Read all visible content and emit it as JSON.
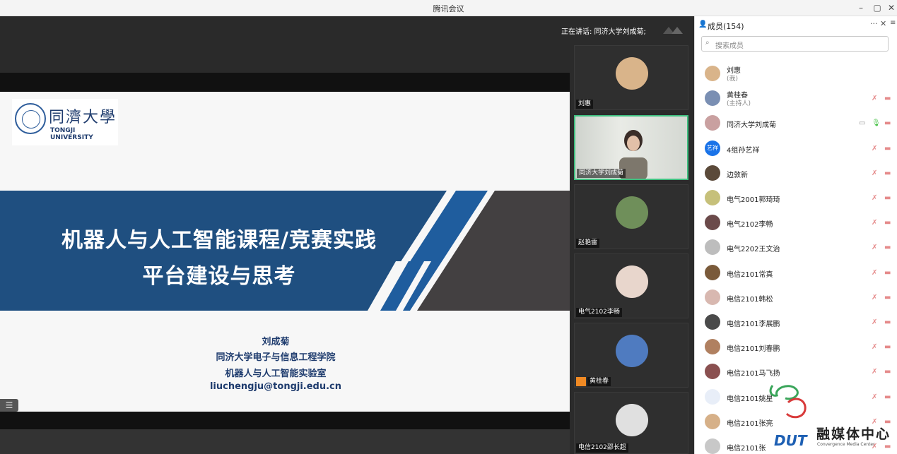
{
  "window": {
    "title": "腾讯会议"
  },
  "speaking": {
    "text": "正在讲话: 同济大学刘成菊;"
  },
  "slide": {
    "logo_cn": "同濟大學",
    "logo_en": "TONGJI UNIVERSITY",
    "title_line1": "机器人与人工智能课程/竞赛实践",
    "title_line2": "平台建设与思考",
    "author": "刘成菊",
    "affiliation1": "同济大学电子与信息工程学院",
    "affiliation2": "机器人与人工智能实验室",
    "email": "liuchengju@tongji.edu.cn"
  },
  "thumbnails": [
    {
      "name": "刘惠"
    },
    {
      "name": "同济大学刘成菊"
    },
    {
      "name": "赵艳雷"
    },
    {
      "name": "电气2102李畅"
    },
    {
      "name": "黄桂春"
    },
    {
      "name": "电信2102邵长超"
    }
  ],
  "panel": {
    "title": "成员(154)",
    "search_placeholder": "搜索成员",
    "members": [
      {
        "name": "刘惠",
        "sub": "(我)"
      },
      {
        "name": "黄桂春",
        "sub": "(主持人)"
      },
      {
        "name": "同济大学刘成菊",
        "sub": ""
      },
      {
        "name": "4组孙艺祥",
        "sub": "",
        "avatar_text": "艺祥"
      },
      {
        "name": "边敦新",
        "sub": ""
      },
      {
        "name": "电气2001郭琦琦",
        "sub": ""
      },
      {
        "name": "电气2102李畅",
        "sub": ""
      },
      {
        "name": "电气2202王文治",
        "sub": ""
      },
      {
        "name": "电信2101常真",
        "sub": ""
      },
      {
        "name": "电信2101韩松",
        "sub": ""
      },
      {
        "name": "电信2101李展鹏",
        "sub": ""
      },
      {
        "name": "电信2101刘春鹏",
        "sub": ""
      },
      {
        "name": "电信2101马飞扬",
        "sub": ""
      },
      {
        "name": "电信2101姚星",
        "sub": ""
      },
      {
        "name": "电信2101张亮",
        "sub": ""
      },
      {
        "name": "电信2101张",
        "sub": ""
      }
    ]
  },
  "watermark": {
    "text": "融媒体中心",
    "sub": "Convergence Media Center",
    "brand": "DUT"
  }
}
